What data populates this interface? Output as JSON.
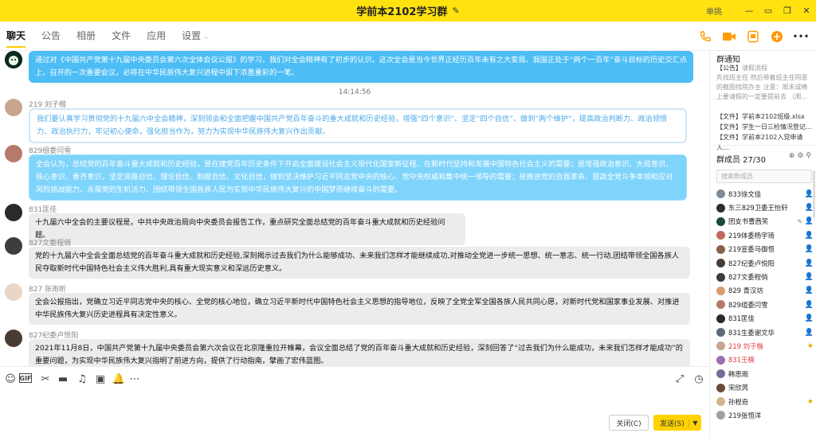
{
  "window": {
    "title": "学前本2102学习群",
    "user": "单挑",
    "controls": [
      "minimize",
      "skin",
      "maximize",
      "close"
    ]
  },
  "tabs": [
    {
      "label": "聊天",
      "active": true
    },
    {
      "label": "公告"
    },
    {
      "label": "相册"
    },
    {
      "label": "文件"
    },
    {
      "label": "应用"
    },
    {
      "label": "设置"
    }
  ],
  "tools": [
    "phone-icon",
    "video-icon",
    "screen-share-icon",
    "add-icon",
    "more-icon"
  ],
  "chat": {
    "timestamp": "14:14:56",
    "messages": [
      {
        "sender": "",
        "text": "通过对《中国共产党第十九届中央委员会第六次全体会议公报》的学习，我们对全会精神有了初步的认识。这次全会是当今世界正经历百年未有之大变局、我国正处于“两个一百年”奋斗目标的历史交汇点上，召开的一次重要会议，必将在中华民族伟大复兴进程中留下浓墨重彩的一笔。"
      },
      {
        "sender": "219 刘子楷",
        "text": "我们要认真学习贯彻党的十九届六中全会精神，深刻领会和全面把握中国共产党百年奋斗的重大成就和历史经验，增强“四个意识”、坚定“四个自信”、做到“两个维护”，提高政治判断力、政治领悟力、政治执行力，牢记初心使命，强化担当作为，努力为实现中华民族伟大复兴作出贡献。"
      },
      {
        "sender": "829组委闫雪",
        "text": "全会认为，总结党的百年奋斗重大成就和历史经验，是在建党百年历史条件下开启全面建设社会主义现代化国家新征程、在新时代坚持和发展中国特色社会主义的需要；是增强政治意识、大局意识、核心意识、看齐意识，坚定道路自信、理论自信、制度自信、文化自信，做到坚决维护习近平同志党中央的核心、党中央权威和集中统一领导的需要；是推进党的自我革命、提高全党斗争本领和应对风险挑战能力、永葆党的生机活力、团结带领全国各族人民为实现中华民族伟大复兴的中国梦而继续奋斗的需要。"
      },
      {
        "sender": "831匡佳",
        "text": "十九届六中全会的主要议程是，中共中央政治局向中央委员会报告工作，重点研究全面总结党的百年奋斗重大成就和历史经验问题。"
      },
      {
        "sender": "827文委程俏",
        "text": "党的十九届六中全会全面总结党的百年奋斗重大成就和历史经验,深刻揭示过去我们为什么能够成功、未来我们怎样才能继续成功,对推动全党进一步统一思想、统一意志、统一行动,团结带领全国各族人民夺取新时代中国特色社会主义伟大胜利,具有重大现实意义和深远历史意义。"
      },
      {
        "sender": "827 张雨昕",
        "text": "全会公报指出，党确立习近平同志党中央的核心、全党的核心地位，确立习近平新时代中国特色社会主义思想的指导地位，反映了全党全军全国各族人民共同心愿，对新时代党和国家事业发展、对推进中华民族伟大复兴历史进程具有决定性意义。"
      },
      {
        "sender": "827纪委卢悦阳",
        "text": "2021年11月8日，中国共产党第十九届中央委员会第六次会议在北京隆重拉开帷幕，会议全面总结了党的百年奋斗重大成就和历史经验，深刻回答了“过去我们为什么能成功，未来我们怎样才能成功”的重要问题，为实现中华民族伟大复兴指明了前进方向，提供了行动指南，擘画了宏伟蓝图。"
      }
    ]
  },
  "composer": {
    "tools": [
      "emoji-icon",
      "gif-icon",
      "scissors-icon",
      "folder-icon",
      "music-icon",
      "image-icon",
      "bell-icon",
      "more-icon"
    ],
    "close_label": "关闭(C)",
    "send_label": "发送(S)"
  },
  "notice": {
    "header": "群通知",
    "announcement_tag": "【公告】",
    "announcement_title": "请假流程",
    "announcement_body": "先找班主任 然后带着班主任同意的截图找院办主 注意：周末或晚上要请假的一定要提前去 （周...",
    "files": [
      {
        "tag": "【文件】",
        "name": "学前本2102班级.xlsx"
      },
      {
        "tag": "【文件】",
        "name": "学生一日三检情况登记..."
      },
      {
        "tag": "【文件】",
        "name": "学前本2102入党申请人..."
      }
    ]
  },
  "members": {
    "header": "群成员 27/30",
    "search_placeholder": "搜索群成员",
    "list": [
      {
        "name": "833徐文佳",
        "badge": "user-icon"
      },
      {
        "name": "东三829卫委王怡轩",
        "badge": "user-icon"
      },
      {
        "name": "团支书曹茜笑",
        "badge": "user-icon",
        "edit": true
      },
      {
        "name": "219体委杨宇琦",
        "badge": "user-icon"
      },
      {
        "name": "219宣委马御恒",
        "badge": "user-icon"
      },
      {
        "name": "827纪委卢悦阳",
        "badge": "user-icon"
      },
      {
        "name": "827文委程俏",
        "badge": "user-icon"
      },
      {
        "name": "829 青汉坊",
        "badge": "user-icon"
      },
      {
        "name": "829组委闫雪",
        "badge": "user-icon"
      },
      {
        "name": "831匡佳",
        "badge": "user-icon"
      },
      {
        "name": "831生委谢文华",
        "badge": "user-icon"
      },
      {
        "name": "219 刘子楷",
        "badge": "star-icon",
        "red": true
      },
      {
        "name": "831王楠",
        "badge": "",
        "red": true
      },
      {
        "name": "韩思雨",
        "badge": ""
      },
      {
        "name": "宋欣芮",
        "badge": ""
      },
      {
        "name": "孙程奇",
        "badge": "star-icon"
      },
      {
        "name": "219张恒洋",
        "badge": ""
      }
    ]
  },
  "colors": {
    "titlebar": "#ffe20f",
    "accent": "#ff9a00",
    "bubble_blue": "#4cbdf5",
    "bubble_gray": "#ececec",
    "send_button": "#ffd200"
  }
}
